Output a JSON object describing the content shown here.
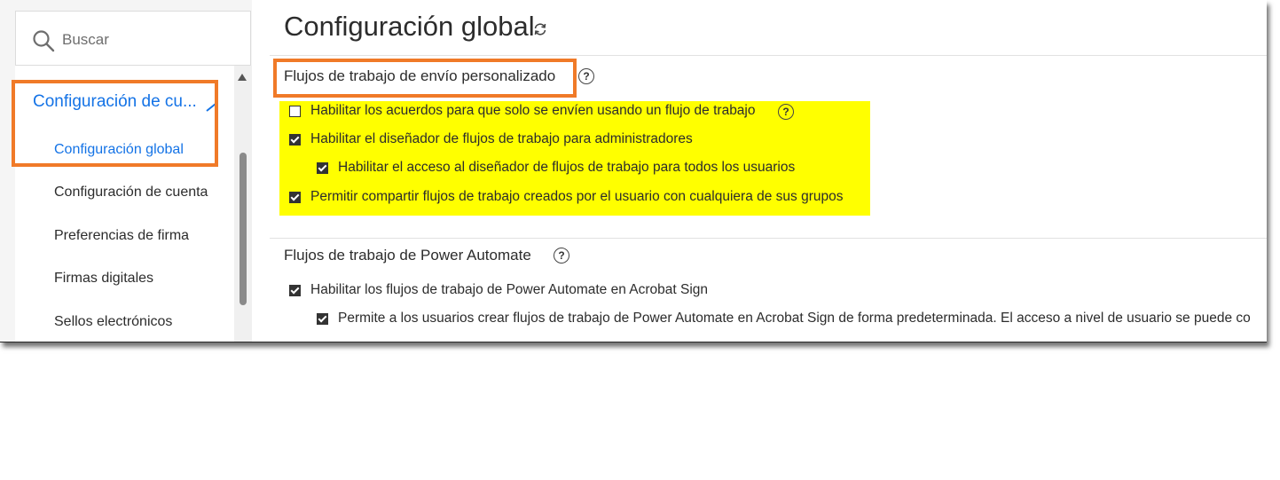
{
  "sidebar": {
    "search_placeholder": "Buscar",
    "group_label": "Configuración de cu...",
    "items": [
      {
        "label": "Configuración global",
        "active": true
      },
      {
        "label": "Configuración de cuenta",
        "active": false
      },
      {
        "label": "Preferencias de firma",
        "active": false
      },
      {
        "label": "Firmas digitales",
        "active": false
      },
      {
        "label": "Sellos electrónicos",
        "active": false
      }
    ]
  },
  "main": {
    "title": "Configuración global",
    "sections": [
      {
        "title": "Flujos de trabajo de envío personalizado",
        "options": [
          {
            "label": "Habilitar los acuerdos para que solo se envíen usando un flujo de trabajo",
            "checked": false,
            "has_help": true
          },
          {
            "label": "Habilitar el diseñador de flujos de trabajo para administradores",
            "checked": true
          },
          {
            "label": "Habilitar el acceso al diseñador de flujos de trabajo para todos los usuarios",
            "checked": true
          },
          {
            "label": "Permitir compartir flujos de trabajo creados por el usuario con cualquiera de sus grupos",
            "checked": true
          }
        ]
      },
      {
        "title": "Flujos de trabajo de Power Automate",
        "options": [
          {
            "label": "Habilitar los flujos de trabajo de Power Automate en Acrobat Sign",
            "checked": true
          },
          {
            "label": "Permite a los usuarios crear flujos de trabajo de Power Automate en Acrobat Sign de forma predeterminada. El acceso a nivel de usuario se puede co",
            "checked": true
          }
        ]
      }
    ]
  },
  "colors": {
    "accent": "#1473e6",
    "highlight_orange": "#f07a28",
    "highlight_yellow": "#ffff00"
  },
  "icons": {
    "search": "search-icon",
    "refresh": "refresh-icon",
    "help": "help-icon",
    "collapse": "chevron-up-icon"
  }
}
